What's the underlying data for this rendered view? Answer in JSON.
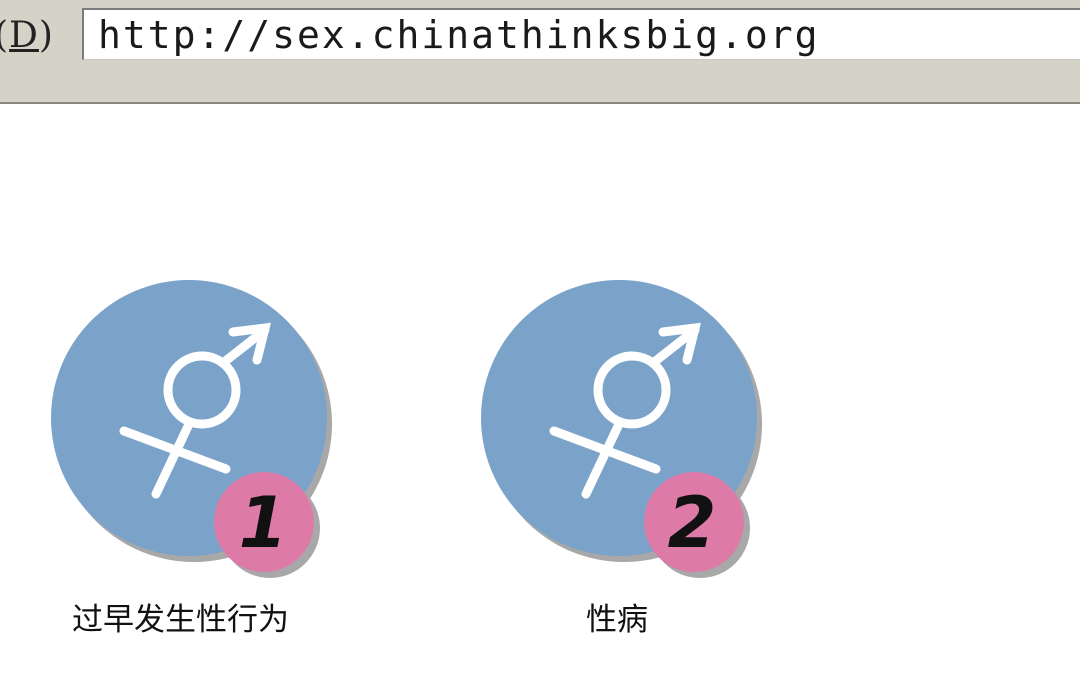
{
  "address_bar": {
    "label_prefix": "(",
    "label_hotkey": "D",
    "label_suffix": ")",
    "url": "http://sex.chinathinksbig.org"
  },
  "items": [
    {
      "number": "1",
      "caption": "过早发生性行为",
      "icon": "gender-symbol-icon"
    },
    {
      "number": "2",
      "caption": "性病",
      "icon": "gender-symbol-icon"
    }
  ],
  "colors": {
    "circle": "#7ba3c9",
    "badge": "#de7aa8",
    "shadow": "#a8a8a8",
    "symbol": "#ffffff",
    "toolbar": "#d5d2c7"
  }
}
